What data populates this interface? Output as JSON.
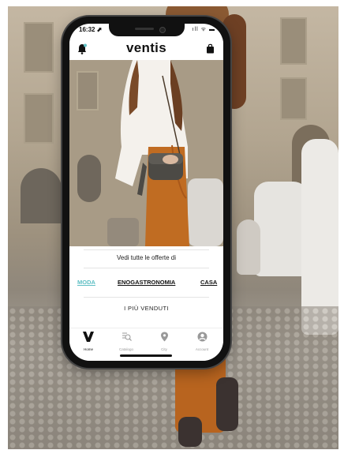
{
  "status_bar": {
    "time": "16:32 ⬈",
    "icons": "ıll ᯤ ▬"
  },
  "header": {
    "logo": "ventis",
    "left_icon": "bell-icon",
    "right_icon": "shopping-bag-icon"
  },
  "offers": {
    "title": "Vedi tutte le offerte di",
    "categories": [
      {
        "label": "MODA",
        "active": true,
        "color": "#5fbfc4"
      },
      {
        "label": "ENOGASTRONOMIA",
        "active": false,
        "color": "#111111"
      },
      {
        "label": "CASA",
        "active": false,
        "color": "#111111"
      }
    ],
    "bestsellers": "I PIÙ VENDUTI"
  },
  "tabbar": {
    "items": [
      {
        "label": "Home",
        "icon": "v-logo-icon"
      },
      {
        "label": "Catalogo",
        "icon": "search-list-icon"
      },
      {
        "label": "City",
        "icon": "location-pin-icon"
      },
      {
        "label": "Account",
        "icon": "account-icon"
      }
    ]
  },
  "colors": {
    "accent": "#5fbfc4",
    "text": "#111111",
    "muted": "#999999"
  }
}
